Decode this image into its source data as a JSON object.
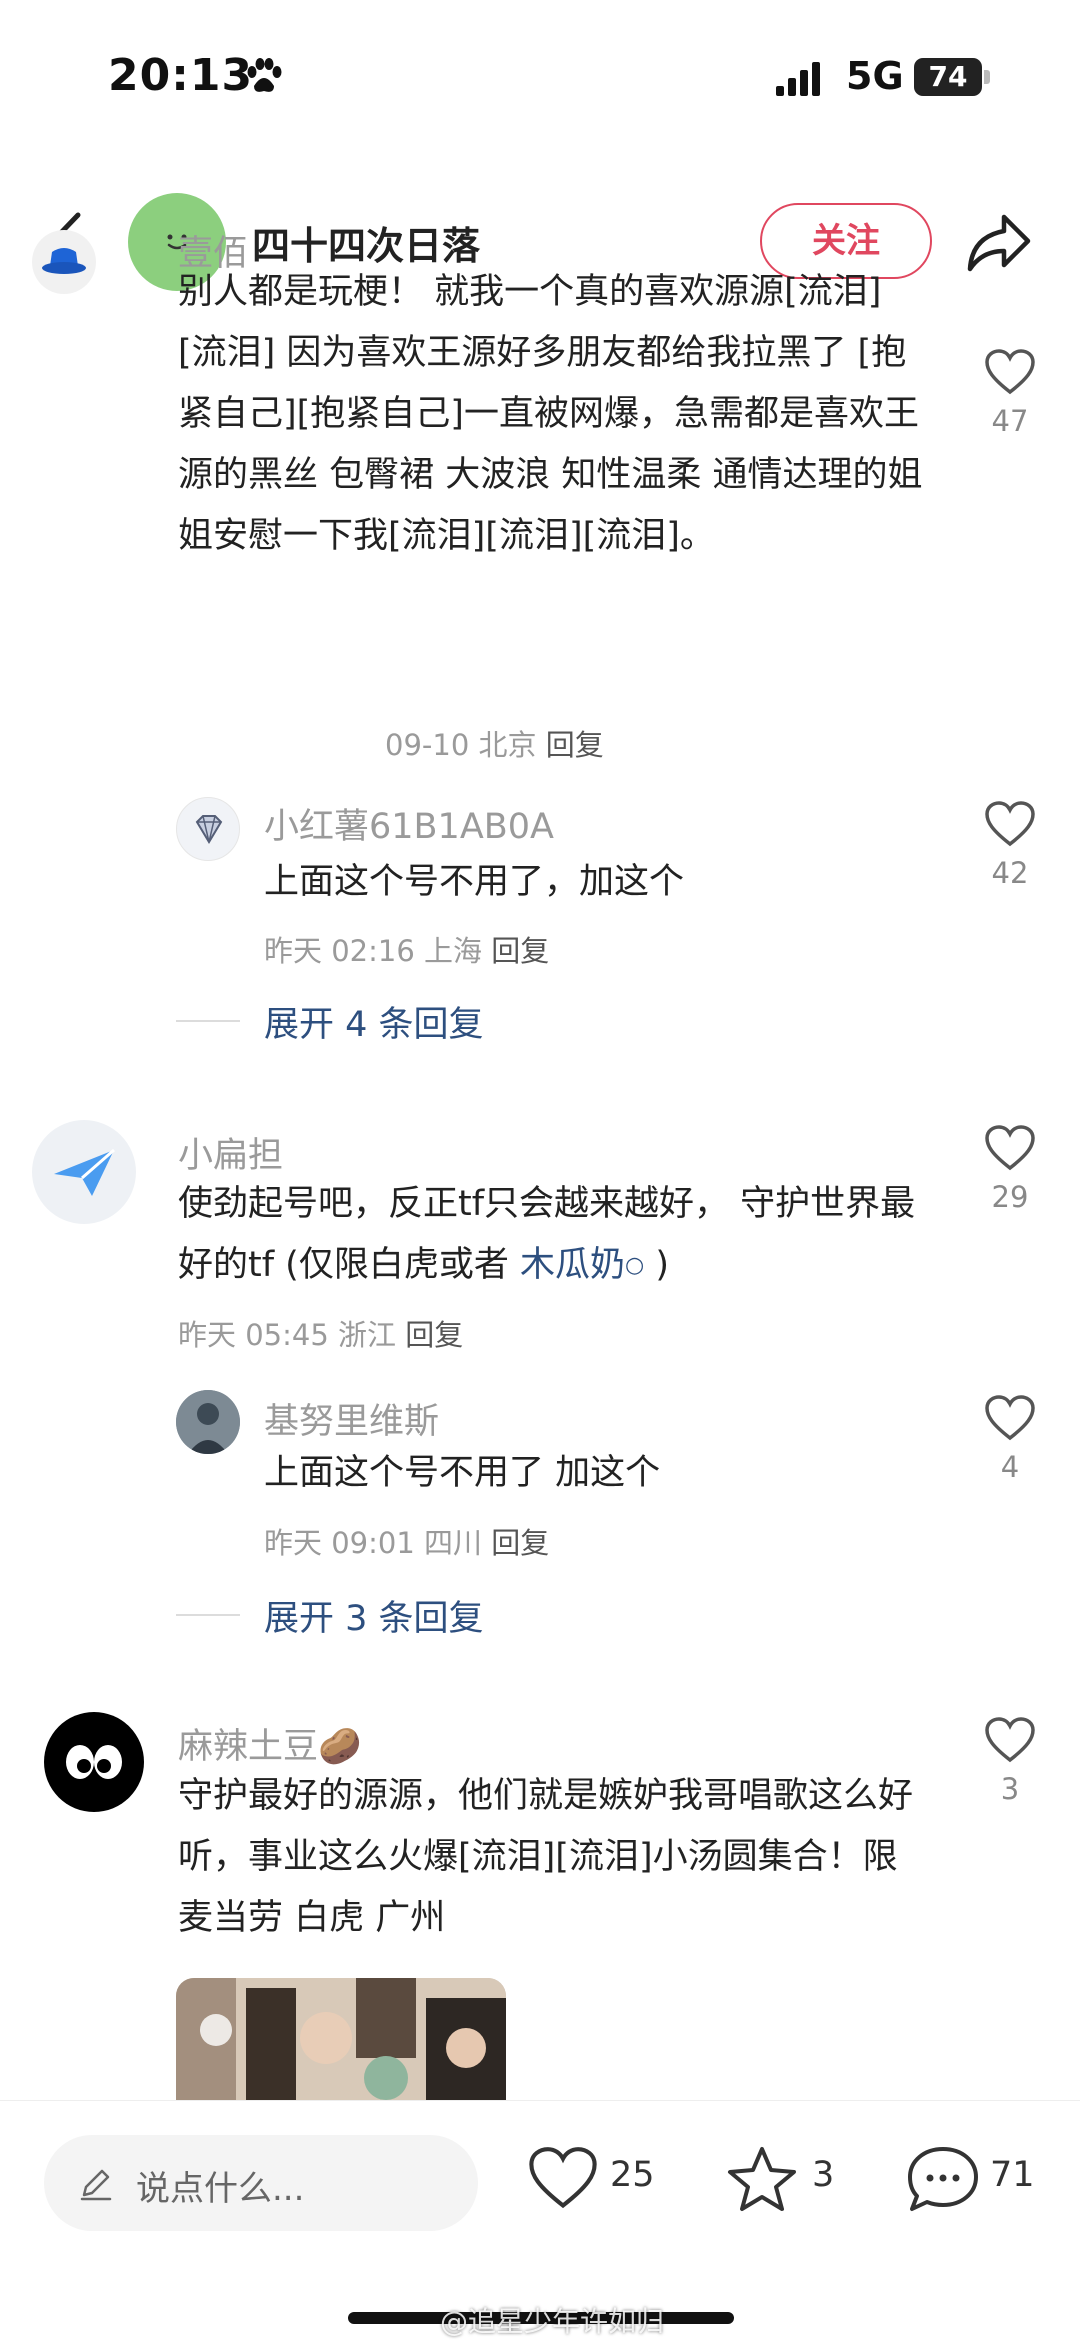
{
  "status_bar": {
    "time": "20:13",
    "network": "5G",
    "battery": "74"
  },
  "header": {
    "title": "四十四次日落",
    "follow_label": "关注"
  },
  "comments": [
    {
      "username": "壹佰",
      "text": "别人都是玩梗！ 就我一个真的喜欢源源[流泪][流泪] 因为喜欢王源好多朋友都给我拉黑了 [抱紧自己][抱紧自己]一直被网爆，急需都是喜欢王源的黑丝 包臀裙 大波浪 知性温柔 通情达理的姐姐安慰一下我[流泪][流泪][流泪]。",
      "date": "09-10",
      "location": "北京",
      "reply_label": "回复",
      "likes": "47",
      "reply": {
        "username": "小红薯61B1AB0A",
        "text": "上面这个号不用了，加这个",
        "date": "昨天 02:16",
        "location": "上海",
        "reply_label": "回复",
        "likes": "42"
      },
      "expand_label": "展开 4 条回复"
    },
    {
      "username": "小扁担",
      "text": "使劲起号吧，反正tf只会越来越好， 守护世界最好的tf (仅限白虎或者",
      "mention": "木瓜奶",
      "text_after": ")",
      "date": "昨天 05:45",
      "location": "浙江",
      "reply_label": "回复",
      "likes": "29",
      "reply": {
        "username": "基努里维斯",
        "text": "上面这个号不用了 加这个",
        "date": "昨天 09:01",
        "location": "四川",
        "reply_label": "回复",
        "likes": "4"
      },
      "expand_label": "展开 3 条回复"
    },
    {
      "username": "麻辣土豆",
      "username_emoji": "🥔",
      "text": "守护最好的源源，他们就是嫉妒我哥唱歌这么好听，事业这么火爆[流泪][流泪]小汤圆集合！限麦当劳 白虎 广州",
      "likes": "3"
    }
  ],
  "bottom_bar": {
    "input_placeholder": "说点什么...",
    "likes": "25",
    "favorites": "3",
    "comments": "71"
  },
  "watermark": "@追星少年许如归"
}
